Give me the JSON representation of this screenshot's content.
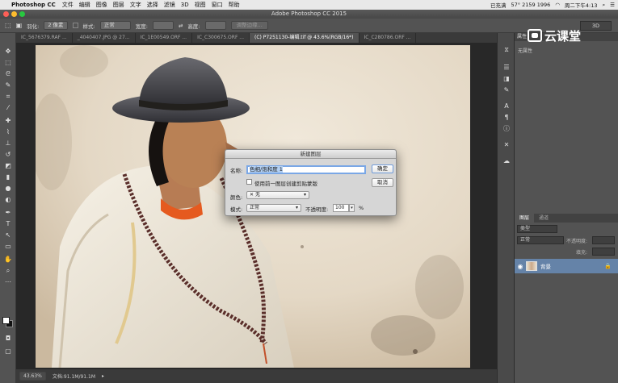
{
  "menubar": {
    "app_name": "Photoshop CC",
    "items": [
      "文件",
      "编辑",
      "图像",
      "图层",
      "文字",
      "选择",
      "滤镜",
      "3D",
      "视图",
      "窗口",
      "帮助"
    ],
    "status": {
      "input": "已充满",
      "account": "57° 2159 1996",
      "clock": "周二下午4:13"
    }
  },
  "window": {
    "title": "Adobe Photoshop CC 2015"
  },
  "options_bar": {
    "feather_label": "羽化:",
    "feather_value": "2 像素",
    "style_label": "样式:",
    "style_value": "正常",
    "width_label": "宽度:",
    "height_label": "高度:",
    "refine_edge": "调整边缘...",
    "workspace": "3D"
  },
  "document_tabs": [
    {
      "label": "IC_5676379.RAF ...",
      "active": false
    },
    {
      "label": "_4040407.JPG @ 27...",
      "active": false
    },
    {
      "label": "IC_1E00549.ORF ...",
      "active": false
    },
    {
      "label": "IC_C300675.ORF ...",
      "active": false
    },
    {
      "label": "(C) P7251130-编辑.tif @ 43.6%(RGB/16*)",
      "active": true
    },
    {
      "label": "IC_C280786.ORF ...",
      "active": false
    }
  ],
  "status_bar": {
    "zoom": "43.63%",
    "doc_info": "文档:91.1M/91.1M"
  },
  "properties_panel": {
    "tab": "属性",
    "subtitle": "无属性"
  },
  "watermark": {
    "text": "云课堂"
  },
  "layers_panel": {
    "tabs": [
      "图层",
      "通道"
    ],
    "kind_filter": "类型",
    "blend_mode": "正常",
    "opacity_label": "不透明度:",
    "fill_label": "填充:",
    "layers": [
      {
        "name": "背景",
        "visible": true,
        "locked": true
      }
    ]
  },
  "dialog": {
    "title": "新建图层",
    "name_label": "名称:",
    "name_value": "色相/饱和度 1",
    "use_previous_label": "使用前一图层创建剪贴蒙版",
    "color_label": "颜色:",
    "color_value": "无",
    "mode_label": "模式:",
    "mode_value": "正常",
    "opacity_label": "不透明度:",
    "opacity_value": "100",
    "opacity_unit": "%",
    "ok_label": "确定",
    "cancel_label": "取消"
  }
}
